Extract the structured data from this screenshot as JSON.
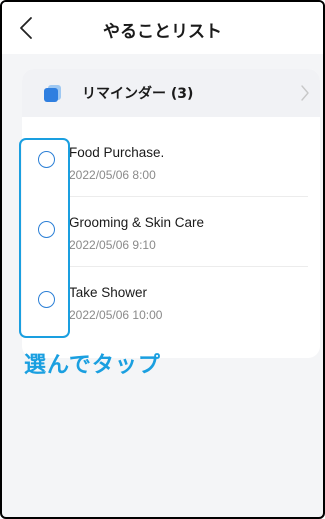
{
  "header": {
    "title": "やることリスト",
    "back_icon": "chevron-left-icon"
  },
  "reminders": {
    "label": "リマインダー (3)",
    "icon": "reminder-icon",
    "chevron_icon": "chevron-right-icon"
  },
  "tasks": [
    {
      "title": "Food Purchase.",
      "time": "2022/05/06 8:00"
    },
    {
      "title": "Grooming & Skin Care",
      "time": "2022/05/06 9:10"
    },
    {
      "title": "Take Shower",
      "time": "2022/05/06 10:00"
    }
  ],
  "callout": {
    "text": "選んでタップ"
  },
  "colors": {
    "accent": "#1a9fe0",
    "circle_border": "#2b7fd6",
    "background": "#f4f5f7"
  }
}
